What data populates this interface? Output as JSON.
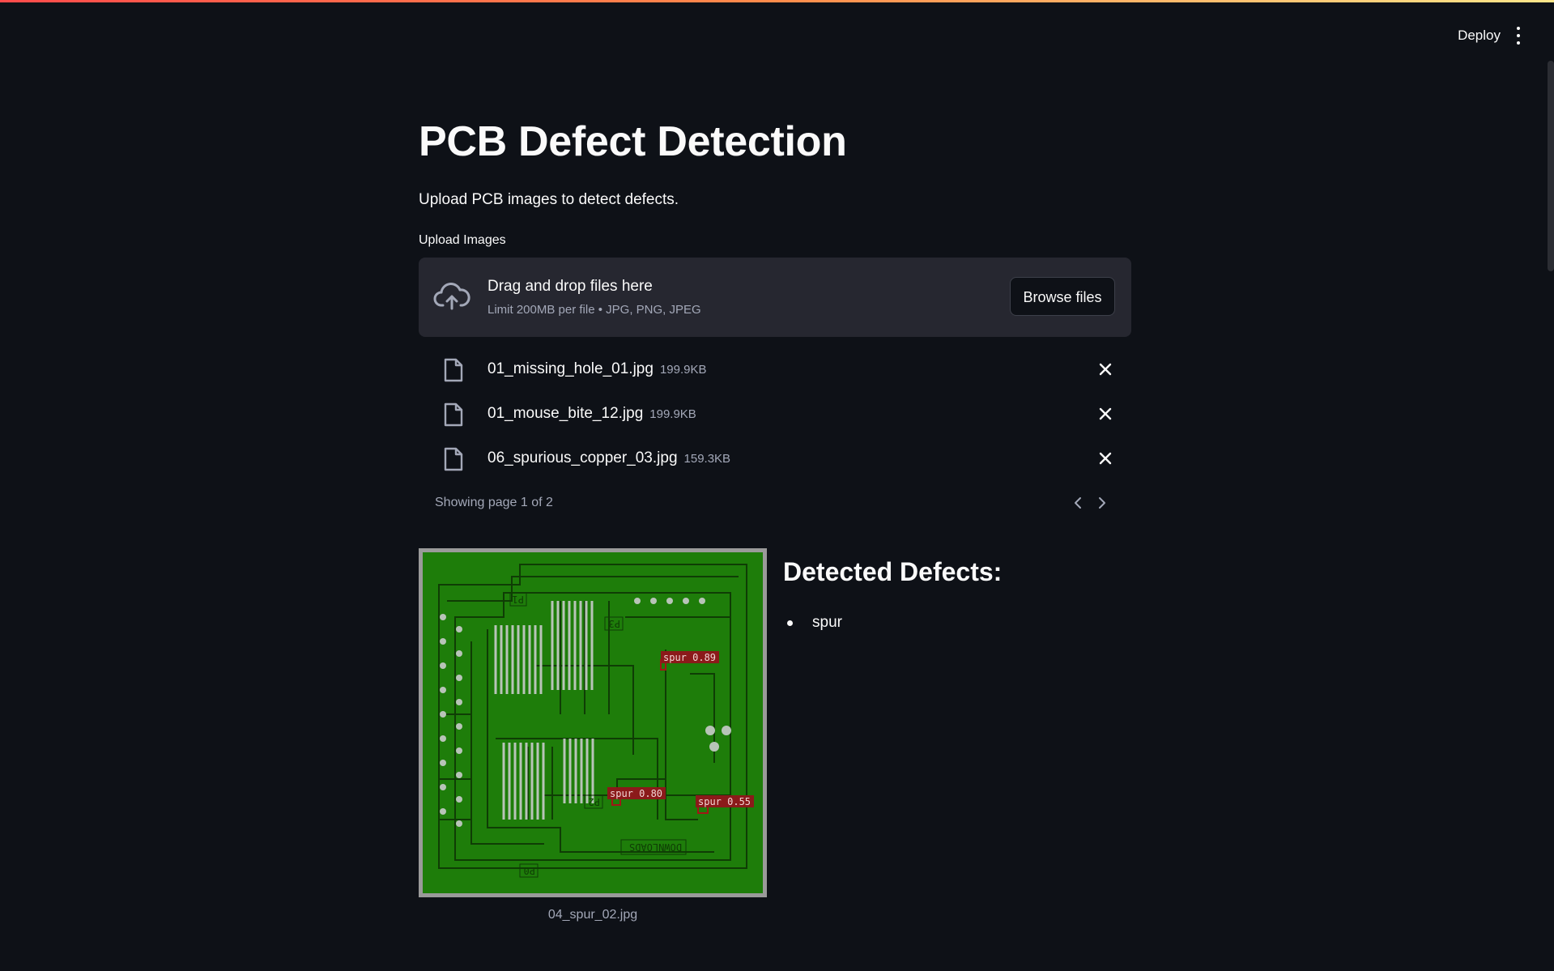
{
  "header": {
    "deploy_label": "Deploy",
    "menu_icon": "kebab-menu-icon"
  },
  "main": {
    "title": "PCB Defect Detection",
    "subtitle": "Upload PCB images to detect defects."
  },
  "uploader": {
    "label": "Upload Images",
    "icon": "cloud-upload-icon",
    "dropzone_text": "Drag and drop files here",
    "limit_text": "Limit 200MB per file • JPG, PNG, JPEG",
    "browse_label": "Browse files",
    "files": [
      {
        "name": "01_missing_hole_01.jpg",
        "size": "199.9KB"
      },
      {
        "name": "01_mouse_bite_12.jpg",
        "size": "199.9KB"
      },
      {
        "name": "06_spurious_copper_03.jpg",
        "size": "159.3KB"
      }
    ],
    "pager_text": "Showing page 1 of 2"
  },
  "result": {
    "image_caption": "04_spur_02.jpg",
    "detections": [
      {
        "label": "spur 0.89"
      },
      {
        "label": "spur 0.80"
      },
      {
        "label": "spur 0.55"
      }
    ],
    "silkscreen": [
      "P1",
      "P3",
      "P2",
      "P0",
      "DOWNLOADS"
    ],
    "heading": "Detected Defects:",
    "defects": [
      "spur"
    ]
  },
  "colors": {
    "background": "#0e1117",
    "surface": "#262730",
    "text": "#fafafa",
    "muted": "#a3a8b8",
    "pcb_green": "#1e7d0a",
    "detection_box": "#8b1a1a"
  }
}
